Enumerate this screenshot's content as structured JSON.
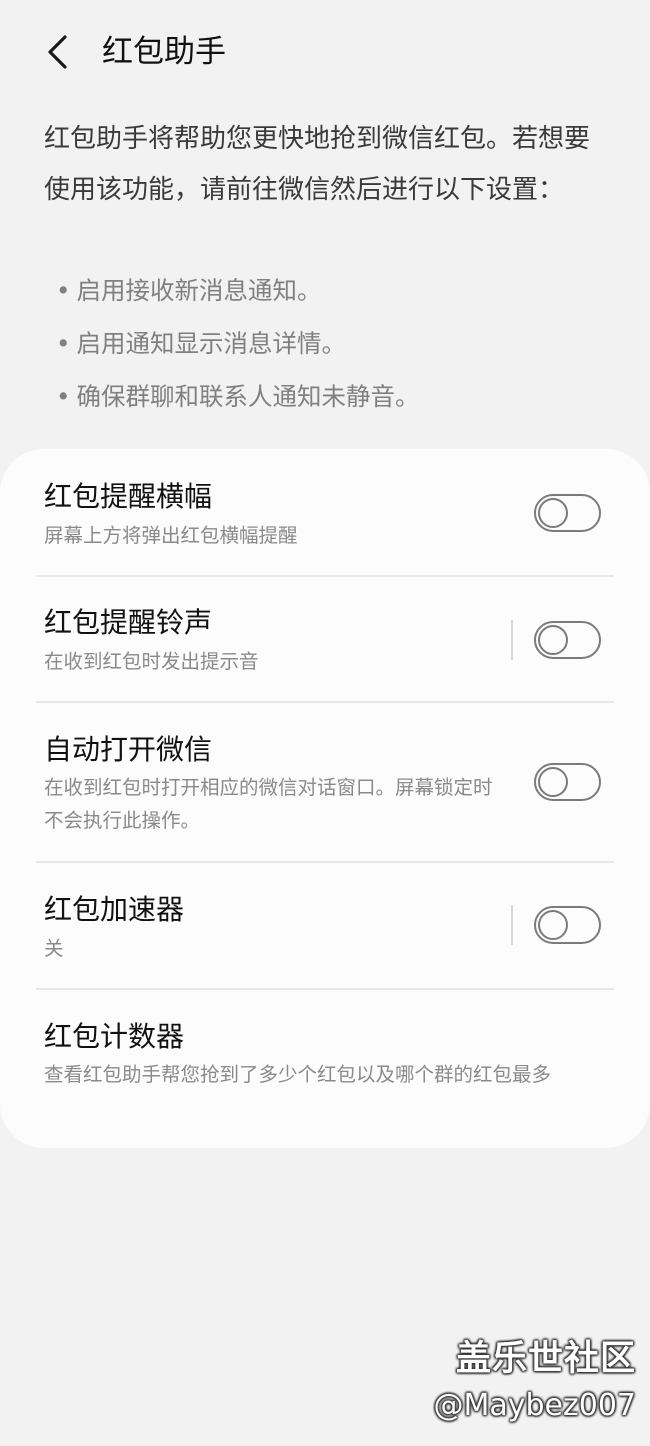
{
  "header": {
    "title": "红包助手",
    "back_icon": "chevron-left-icon"
  },
  "intro": {
    "text": "红包助手将帮助您更快地抢到微信红包。若想要使用该功能，请前往微信然后进行以下设置：",
    "bullets": [
      "启用接收新消息通知。",
      "启用通知显示消息详情。",
      "确保群聊和联系人通知未静音。"
    ]
  },
  "settings": [
    {
      "title": "红包提醒横幅",
      "desc": "屏幕上方将弹出红包横幅提醒",
      "toggle": "off"
    },
    {
      "title": "红包提醒铃声",
      "desc": "在收到红包时发出提示音",
      "toggle": "off"
    },
    {
      "title": "自动打开微信",
      "desc": "在收到红包时打开相应的微信对话窗口。屏幕锁定时不会执行此操作。",
      "toggle": "off"
    },
    {
      "title": "红包加速器",
      "desc": "关",
      "toggle": "off"
    },
    {
      "title": "红包计数器",
      "desc": "查看红包助手帮您抢到了多少个红包以及哪个群的红包最多"
    }
  ],
  "watermark": {
    "site": "盖乐世社区",
    "user": "@Maybez007"
  },
  "colors": {
    "background": "#f2f2f2",
    "card": "#fcfcfc",
    "toggle_off": "#7b7b7b"
  }
}
